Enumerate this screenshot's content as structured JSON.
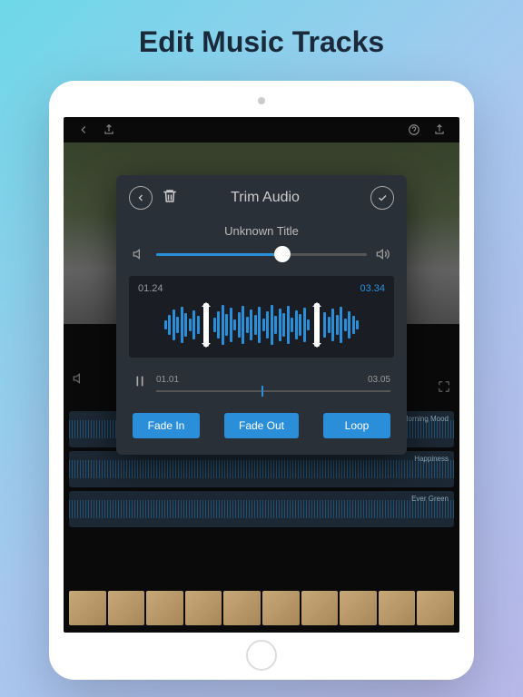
{
  "page": {
    "title": "Edit Music Tracks"
  },
  "modal": {
    "title": "Trim Audio",
    "subtitle": "Unknown Title",
    "volume": {
      "percent": 60
    },
    "trim": {
      "start": "01.24",
      "end": "03.34"
    },
    "playback": {
      "start": "01.01",
      "end": "03.05",
      "position": 45
    },
    "buttons": {
      "fadeIn": "Fade In",
      "fadeOut": "Fade Out",
      "loop": "Loop"
    }
  },
  "background": {
    "tracks": [
      "Morning Mood",
      "Happiness",
      "Ever Green"
    ]
  }
}
